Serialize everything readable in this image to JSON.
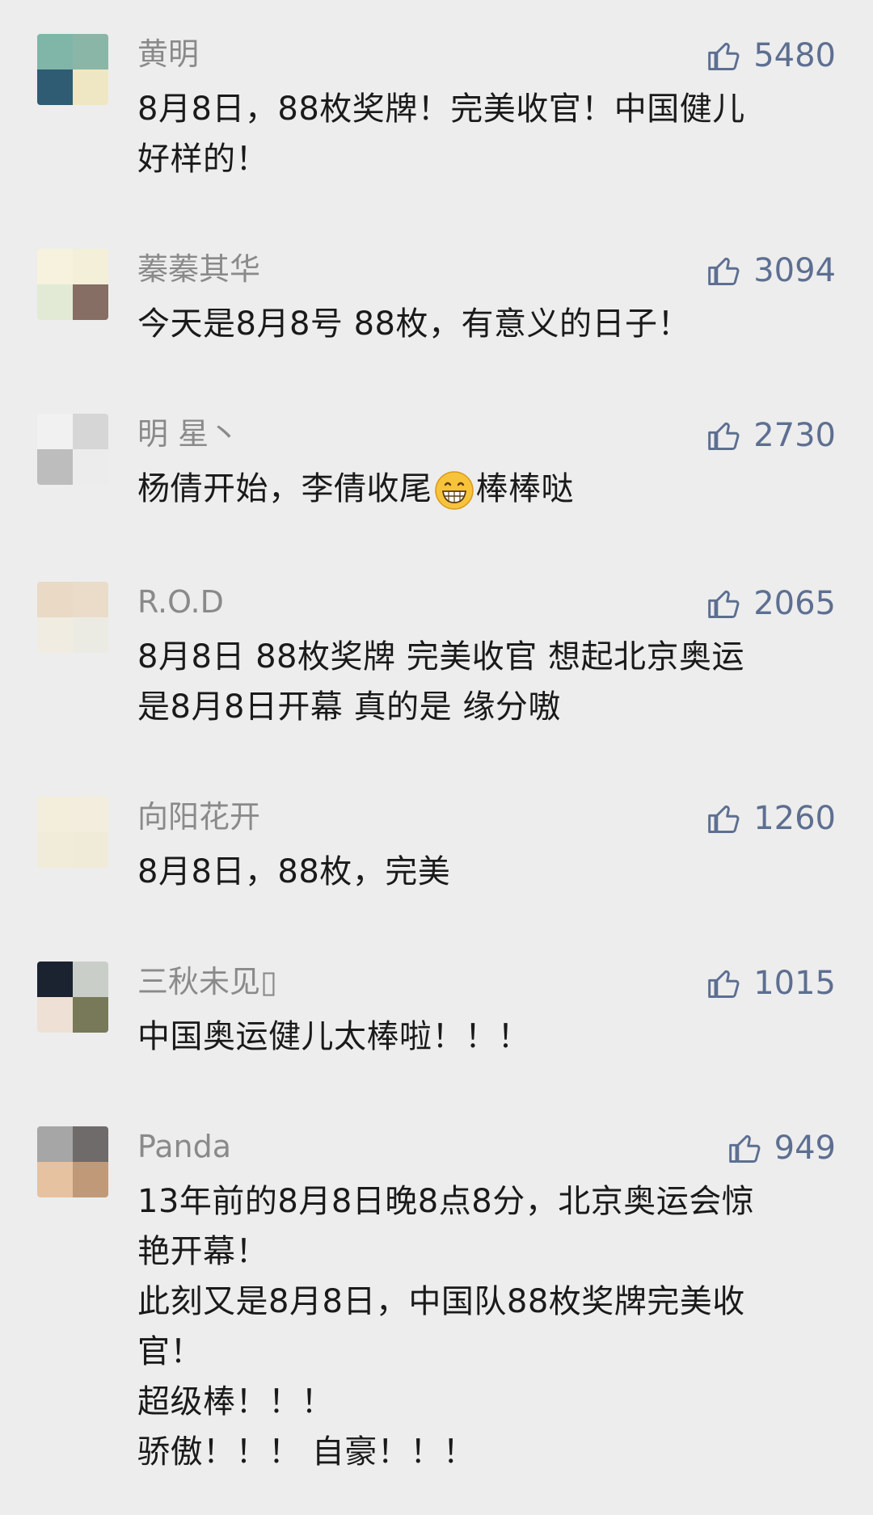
{
  "comments": [
    {
      "name": "黄明",
      "likes": "5480",
      "lines": [
        "8月8日，88枚奖牌！完美收官！中国健儿",
        "好样的！"
      ],
      "avatar": [
        "#7fb6a8",
        "#8ab6a8",
        "#2f5b73",
        "#efe7c4"
      ]
    },
    {
      "name": "蓁蓁其华",
      "likes": "3094",
      "lines": [
        "今天是8月8号 88枚，有意义的日子！"
      ],
      "avatar": [
        "#f6f2dd",
        "#f3efd8",
        "#e2ead6",
        "#866e64"
      ]
    },
    {
      "name": "明 星丶",
      "likes": "2730",
      "lines_a": "杨倩开始，李倩收尾",
      "lines_b": "棒棒哒",
      "emoji": "grinning-face",
      "avatar": [
        "#f1f1f1",
        "#d6d6d6",
        "#bdbdbd",
        "#ececec"
      ]
    },
    {
      "name": "R.O.D",
      "likes": "2065",
      "lines": [
        "8月8日 88枚奖牌 完美收官 想起北京奥运",
        "是8月8日开幕 真的是 缘分嗷"
      ],
      "avatar": [
        "#ead9c5",
        "#eadcc9",
        "#f0ece2",
        "#ecebe3"
      ]
    },
    {
      "name": "向阳花开",
      "likes": "1260",
      "lines": [
        "8月8日，88枚，完美"
      ],
      "avatar": [
        "#f3eedc",
        "#f2eddc",
        "#f1ecda",
        "#f0ebd9"
      ]
    },
    {
      "name": "三秋未见▯",
      "likes": "1015",
      "lines": [
        "中国奥运健儿太棒啦！！！"
      ],
      "avatar": [
        "#1b2230",
        "#c9cec9",
        "#efe0d6",
        "#787958"
      ]
    },
    {
      "name": "Panda",
      "likes": "949",
      "lines": [
        "13年前的8月8日晚8点8分，北京奥运会惊",
        "艳开幕！",
        "此刻又是8月8日，中国队88枚奖牌完美收",
        "官！",
        "超级棒！！！",
        "骄傲！！！ 自豪！！！"
      ],
      "avatar": [
        "#a6a6a6",
        "#6f6b6b",
        "#e7c2a0",
        "#c09a78"
      ]
    }
  ],
  "icons": {
    "like": "thumbs-up-icon"
  },
  "colors": {
    "background": "#ededed",
    "name": "#8a8a8a",
    "likes": "#5d6f91",
    "text": "#1a1a1a"
  }
}
